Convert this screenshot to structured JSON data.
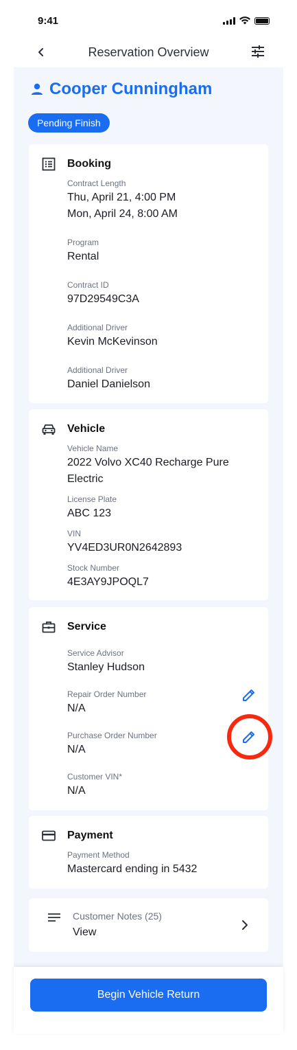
{
  "status_bar": {
    "time": "9:41"
  },
  "header": {
    "title": "Reservation Overview"
  },
  "customer": {
    "name": "Cooper Cunningham",
    "status": "Pending Finish"
  },
  "booking": {
    "title": "Booking",
    "contract_length_label": "Contract Length",
    "contract_start": "Thu, April 21, 4:00 PM",
    "contract_end": "Mon, April 24, 8:00 AM",
    "program_label": "Program",
    "program": "Rental",
    "contract_id_label": "Contract ID",
    "contract_id": "97D29549C3A",
    "additional_driver_1_label": "Additional Driver",
    "additional_driver_1": "Kevin McKevinson",
    "additional_driver_2_label": "Additional Driver",
    "additional_driver_2": "Daniel Danielson"
  },
  "vehicle": {
    "title": "Vehicle",
    "name_label": "Vehicle Name",
    "name_line1": "2022 Volvo XC40 Recharge Pure",
    "name_line2": "Electric",
    "plate_label": "License Plate",
    "plate": "ABC 123",
    "vin_label": "VIN",
    "vin": "YV4ED3UR0N2642893",
    "stock_label": "Stock Number",
    "stock": "4E3AY9JPOQL7"
  },
  "service": {
    "title": "Service",
    "advisor_label": "Service Advisor",
    "advisor": "Stanley Hudson",
    "repair_order_label": "Repair Order Number",
    "repair_order": "N/A",
    "purchase_order_label": "Purchase Order Number",
    "purchase_order": "N/A",
    "customer_vin_label": "Customer VIN*",
    "customer_vin": "N/A"
  },
  "payment": {
    "title": "Payment",
    "method_label": "Payment Method",
    "method": "Mastercard ending in 5432"
  },
  "notes": {
    "label": "Customer Notes (25)",
    "action": "View"
  },
  "footer": {
    "primary_button": "Begin Vehicle Return"
  },
  "colors": {
    "accent": "#1a6df0",
    "highlight": "#f52a10",
    "background": "#f3f6fc"
  },
  "icons": {
    "back": "chevron-left-icon",
    "filter": "sliders-icon",
    "person": "person-icon",
    "booking": "list-document-icon",
    "vehicle": "car-icon",
    "service": "briefcase-icon",
    "payment": "credit-card-icon",
    "edit": "pencil-icon",
    "notes": "lines-icon",
    "chevron": "chevron-right-icon"
  }
}
